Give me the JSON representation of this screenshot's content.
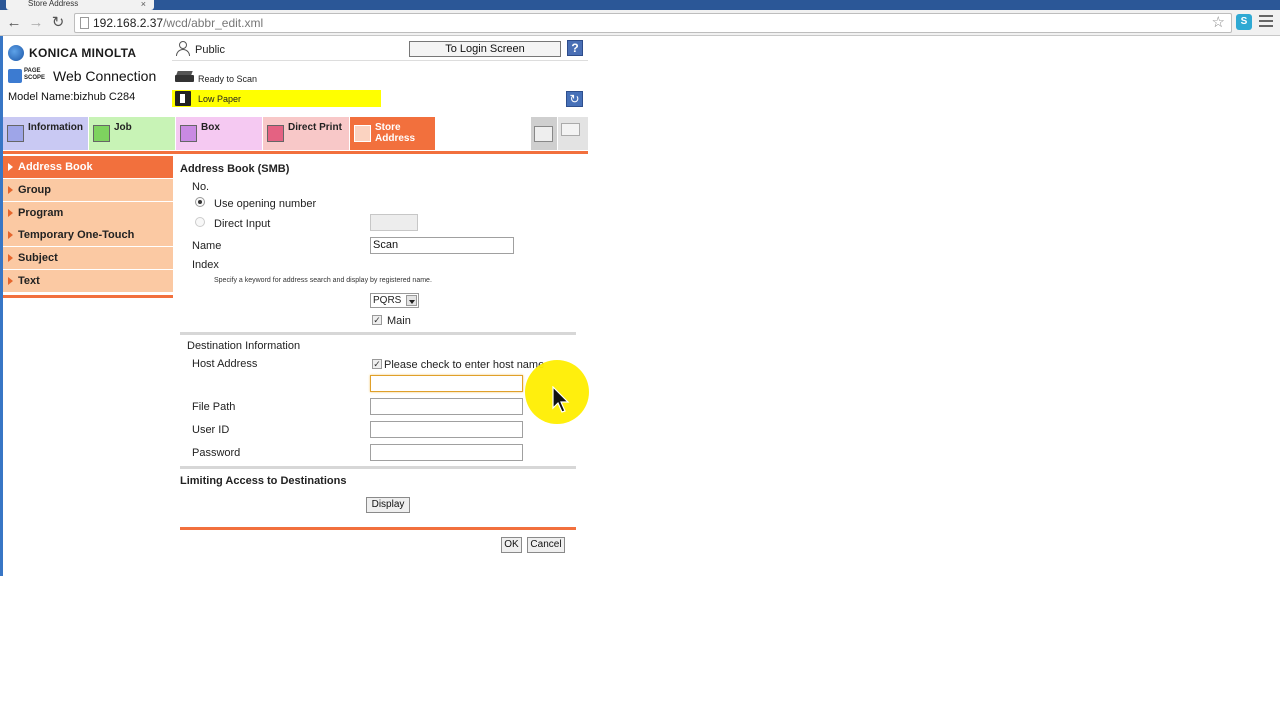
{
  "browser": {
    "tab_title": "Store Address",
    "tab_close": "×",
    "url_host": "192.168.2.37",
    "url_path": "/wcd/abbr_edit.xml"
  },
  "header": {
    "brand": "KONICA MINOLTA",
    "pagescope_line1": "PAGE",
    "pagescope_line2": "SCOPE",
    "product": "Web Connection",
    "model_name": "Model Name:bizhub C284",
    "user": "Public",
    "login_button": "To Login Screen",
    "help": "?",
    "status_ready": "Ready to Scan",
    "status_warning": "Low Paper",
    "warning_color": "#ffff00"
  },
  "tabs": [
    {
      "label": "Information"
    },
    {
      "label": "Job"
    },
    {
      "label": "Box"
    },
    {
      "label": "Direct Print"
    },
    {
      "label": "Store\nAddress",
      "line1": "Store",
      "line2": "Address"
    }
  ],
  "sidebar": {
    "items": [
      {
        "label": "Address Book"
      },
      {
        "label": "Group"
      },
      {
        "label": "Program"
      },
      {
        "label": "Temporary One-Touch"
      },
      {
        "label": "Subject"
      },
      {
        "label": "Text"
      }
    ]
  },
  "form": {
    "title": "Address Book (SMB)",
    "no_label": "No.",
    "use_opening_number": "Use opening number",
    "direct_input": "Direct Input",
    "name_label": "Name",
    "name_value": "Scan",
    "index_label": "Index",
    "index_hint": "Specify a keyword for address search and display by registered name.",
    "index_value": "PQRS",
    "main_label": "Main",
    "destination_info": "Destination Information",
    "host_address_label": "Host Address",
    "host_check_label": "Please check to enter host name",
    "file_path_label": "File Path",
    "user_id_label": "User ID",
    "password_label": "Password",
    "limiting_access": "Limiting Access to Destinations",
    "display_button": "Display",
    "ok_button": "OK",
    "cancel_button": "Cancel"
  },
  "colors": {
    "accent": "#f2703d",
    "sidebar_bg": "#fbc9a3",
    "chrome_blue": "#2b5797"
  }
}
